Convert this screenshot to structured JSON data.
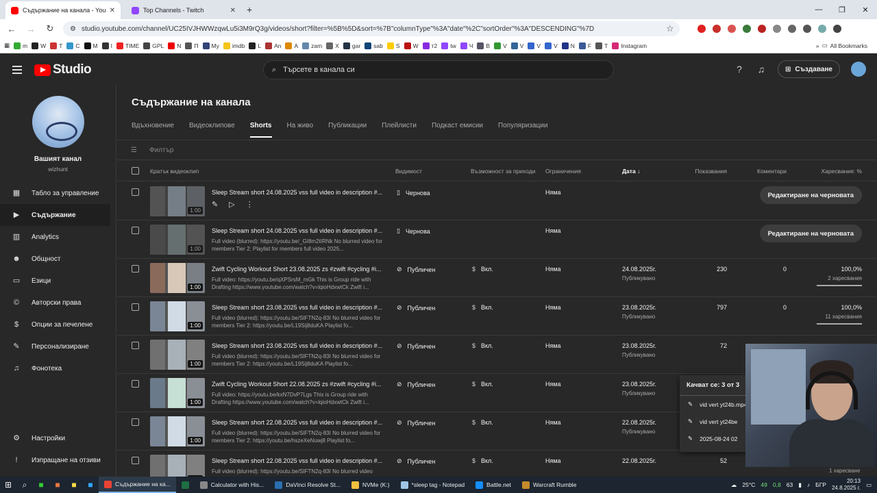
{
  "browser": {
    "tabs": [
      {
        "title": "Съдържание на канала - YouT",
        "color": "#ff0000"
      },
      {
        "title": "Top Channels - Twitch",
        "color": "#9146ff"
      }
    ],
    "url": "studio.youtube.com/channel/UC25IVJHWWzqwLu5i3M9rQ3g/videos/short?filter=%5B%5D&sort=%7B\"columnType\"%3A\"date\"%2C\"sortOrder\"%3A\"DESCENDING\"%7D",
    "bookmarks": [
      "m",
      "W",
      "T",
      "C",
      "M",
      "I",
      "TIME",
      "GPL",
      "N",
      "П",
      "My",
      "imdb",
      "L",
      "An",
      "A",
      "zam",
      "X",
      "gar",
      "sab",
      "S",
      "W",
      "т2",
      "tw",
      "Ч",
      "B",
      "V",
      "V",
      "V",
      "V",
      "N",
      "F",
      "T",
      "Instagram"
    ],
    "all_bookmarks": "All Bookmarks"
  },
  "header": {
    "logo": "Studio",
    "search_placeholder": "Търсете в канала си",
    "create_label": "Създаване"
  },
  "sidebar": {
    "channel_name": "Вашият канал",
    "handle": "wizhunt",
    "items": [
      {
        "label": "Табло за управление",
        "icon": "dashboard-icon",
        "glyph": "▦"
      },
      {
        "label": "Съдържание",
        "icon": "content-icon",
        "glyph": "▶",
        "active": true
      },
      {
        "label": "Analytics",
        "icon": "analytics-icon",
        "glyph": "▥"
      },
      {
        "label": "Общност",
        "icon": "community-icon",
        "glyph": "☻"
      },
      {
        "label": "Езици",
        "icon": "subtitles-icon",
        "glyph": "▭"
      },
      {
        "label": "Авторски права",
        "icon": "copyright-icon",
        "glyph": "©"
      },
      {
        "label": "Опции за печелене",
        "icon": "monetization-icon",
        "glyph": "$"
      },
      {
        "label": "Персонализиране",
        "icon": "customization-icon",
        "glyph": "✎"
      },
      {
        "label": "Фонотека",
        "icon": "audio-library-icon",
        "glyph": "♫"
      }
    ],
    "bottom": [
      {
        "label": "Настройки",
        "icon": "settings-icon",
        "glyph": "⚙"
      },
      {
        "label": "Изпращане на отзиви",
        "icon": "feedback-icon",
        "glyph": "!"
      }
    ]
  },
  "main": {
    "title": "Съдържание на канала",
    "tabs": [
      "Вдъхновение",
      "Видеоклипове",
      "Shorts",
      "На живо",
      "Публикации",
      "Плейлисти",
      "Подкаст емисии",
      "Популяризации"
    ],
    "active_tab": "Shorts",
    "filter_placeholder": "Филтър",
    "columns": {
      "video": "Кратък видеоклип",
      "visibility": "Видимост",
      "monetization": "Възможност за приходи",
      "restrictions": "Ограничения",
      "date": "Дата",
      "views": "Показвания",
      "comments": "Коментари",
      "likes": "Харесвания: %"
    },
    "rows": [
      {
        "title": "Sleep Stream short 24.08.2025 vss full video in description #...",
        "desc": "",
        "duration": "1:00",
        "visibility": "Чернова",
        "vis_icon": "draft-icon",
        "monetization": "",
        "restrictions": "Няма",
        "date": "",
        "date_status": "",
        "views": "",
        "comments": "",
        "likes": "",
        "likes_count": "",
        "draft": true,
        "hover": true
      },
      {
        "title": "Sleep Stream short 24.08.2025 vss full video in description #...",
        "desc": "Full video (blurred): https://youtu.be/_GI8m2tIRNk No blurred video for members Tier 2: Playlist for members full video 2025...",
        "duration": "1:00",
        "visibility": "Чернова",
        "vis_icon": "draft-icon",
        "monetization": "",
        "restrictions": "Няма",
        "date": "",
        "date_status": "",
        "views": "",
        "comments": "",
        "likes": "",
        "likes_count": "",
        "draft": true
      },
      {
        "title": "Zwift Cycling Workout Short 23.08.2025 zs #zwift #cycling #i...",
        "desc": "Full video: https://youtu.be/qXPSrsM_mGk This is Group ride with Drafting https://www.youtube.com/watch?v=lqioHdxwtCk Zwift i...",
        "duration": "1:00",
        "visibility": "Публичен",
        "vis_icon": "public-icon",
        "monetization": "Вкл.",
        "restrictions": "Няма",
        "date": "24.08.2025г.",
        "date_status": "Публикувано",
        "views": "230",
        "comments": "0",
        "likes": "100,0%",
        "likes_count": "2 харесвания"
      },
      {
        "title": "Sleep Stream short 23.08.2025 vss full video in description #...",
        "desc": "Full video (blurred): https://youtu.be/SIFTN2q-83I No blurred video for members Tier 2: https://youtu.be/L19Sij8duKA Playlist fo...",
        "duration": "1:00",
        "visibility": "Публичен",
        "vis_icon": "public-icon",
        "monetization": "Вкл.",
        "restrictions": "Няма",
        "date": "23.08.2025г.",
        "date_status": "Публикувано",
        "views": "797",
        "comments": "0",
        "likes": "100,0%",
        "likes_count": "11 харесвания"
      },
      {
        "title": "Sleep Stream short 23.08.2025 vss full video in description #...",
        "desc": "Full video (blurred): https://youtu.be/SIFTN2q-83I No blurred video for members Tier 2: https://youtu.be/L19Sij8duKA Playlist fo...",
        "duration": "1:00",
        "visibility": "Публичен",
        "vis_icon": "public-icon",
        "monetization": "Вкл.",
        "restrictions": "Няма",
        "date": "23.08.2025г.",
        "date_status": "Публикувано",
        "views": "72",
        "comments": "",
        "likes": "",
        "likes_count": ""
      },
      {
        "title": "Zwift Cycling Workout Short 22.08.2025 zs #zwift #cycling #i...",
        "desc": "Full video: https://youtu.be/kxN7DvP7Lgs This is Group ride with Drafting https://www.youtube.com/watch?v=lqioHdxwtCk Zwift i...",
        "duration": "1:00",
        "visibility": "Публичен",
        "vis_icon": "public-icon",
        "monetization": "Вкл.",
        "restrictions": "Няма",
        "date": "23.08.2025г.",
        "date_status": "Публикувано",
        "views": "",
        "comments": "",
        "likes": "",
        "likes_count": ""
      },
      {
        "title": "Sleep Stream short 22.08.2025 vss full video in description #...",
        "desc": "Full video (blurred): https://youtu.be/SIFTN2q-83I No blurred video for members Tier 2: https://youtu.be/hszeXeNuwj8 Playlist fo...",
        "duration": "1:00",
        "visibility": "Публичен",
        "vis_icon": "public-icon",
        "monetization": "Вкл.",
        "restrictions": "Няма",
        "date": "22.08.2025г.",
        "date_status": "Публикувано",
        "views": "",
        "comments": "",
        "likes": "",
        "likes_count": ""
      },
      {
        "title": "Sleep Stream short 22.08.2025 vss full video in description #...",
        "desc": "Full video (blurred): https://youtu.be/SIFTN2q-83I No blurred video",
        "duration": "1:00",
        "visibility": "Публичен",
        "vis_icon": "public-icon",
        "monetization": "Вкл.",
        "restrictions": "Няма",
        "date": "22.08.2025г.",
        "date_status": "",
        "views": "52",
        "comments": "",
        "likes": "",
        "likes_count": ""
      }
    ],
    "draft_button": "Редактиране на черновата"
  },
  "upload_overlay": {
    "title": "Качват се: 3 от 3",
    "items": [
      "vid vert yt24b.mp4",
      "vid vert yt24be",
      "2025-08-24 02"
    ]
  },
  "bottom_status": "1 харесване",
  "taskbar": {
    "apps": [
      {
        "label": "Съдържание на ка...",
        "color": "#ea4335",
        "active": true
      },
      {
        "label": "",
        "color": "#1d6f42"
      },
      {
        "label": "Calculator with His...",
        "color": "#888888"
      },
      {
        "label": "DaVinci Resolve St...",
        "color": "#2a6fb0"
      },
      {
        "label": "NVMe (K:)",
        "color": "#f0c040"
      },
      {
        "label": "*sleep tag - Notepad",
        "color": "#9fc6e8"
      },
      {
        "label": "Battle.net",
        "color": "#148eff"
      },
      {
        "label": "Warcraft Rumble",
        "color": "#c58a2a"
      }
    ],
    "weather": "25°C",
    "tray": [
      "49",
      "0,8",
      "63"
    ],
    "lang": "БГР",
    "time": "20:13",
    "date": "24.8.2025 г."
  }
}
